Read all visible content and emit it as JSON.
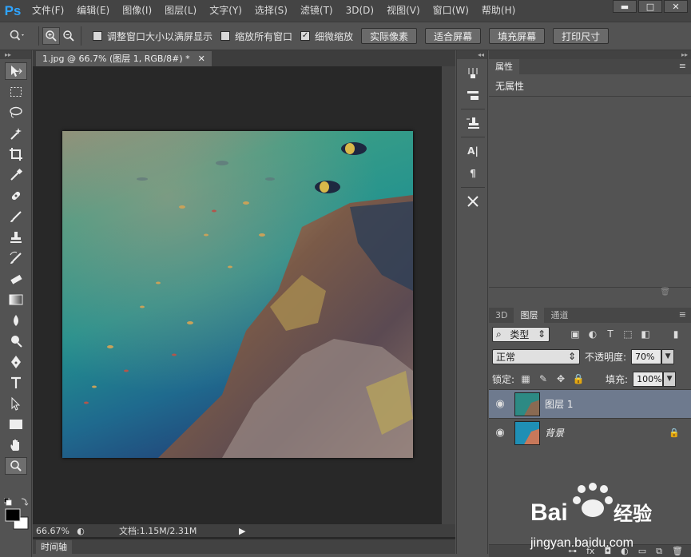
{
  "app": {
    "logo": "Ps"
  },
  "menu": [
    "文件(F)",
    "编辑(E)",
    "图像(I)",
    "图层(L)",
    "文字(Y)",
    "选择(S)",
    "滤镜(T)",
    "3D(D)",
    "视图(V)",
    "窗口(W)",
    "帮助(H)"
  ],
  "window_controls": [
    "minimize-icon",
    "maximize-icon",
    "close-icon"
  ],
  "options": {
    "resize_windows": {
      "label": "调整窗口大小以满屏显示",
      "checked": false
    },
    "zoom_all": {
      "label": "缩放所有窗口",
      "checked": false
    },
    "scrubby_zoom": {
      "label": "细微缩放",
      "checked": true
    },
    "buttons": [
      "实际像素",
      "适合屏幕",
      "填充屏幕",
      "打印尺寸"
    ]
  },
  "document": {
    "tab_title": "1.jpg @ 66.7% (图层 1, RGB/8#) *",
    "zoom": "66.67%",
    "doc_info": "文档:1.15M/2.31M",
    "timeline_label": "时间轴"
  },
  "properties": {
    "tab": "属性",
    "text": "无属性"
  },
  "layers": {
    "tabs": [
      "3D",
      "图层",
      "通道"
    ],
    "active_tab": "图层",
    "filter_kind": "类型",
    "blend_mode": "正常",
    "opacity_label": "不透明度:",
    "opacity": "70%",
    "lock_label": "锁定:",
    "fill_label": "填充:",
    "fill": "100%",
    "items": [
      {
        "name": "图层 1",
        "selected": true,
        "locked": false
      },
      {
        "name": "背景",
        "selected": false,
        "locked": true
      }
    ]
  },
  "watermark": {
    "line1": "Bai",
    "line2": "经验",
    "line3": "jingyan.baidu.com"
  },
  "colors": {
    "accent": "#2fa4ff",
    "selection": "#6e7a8e"
  }
}
